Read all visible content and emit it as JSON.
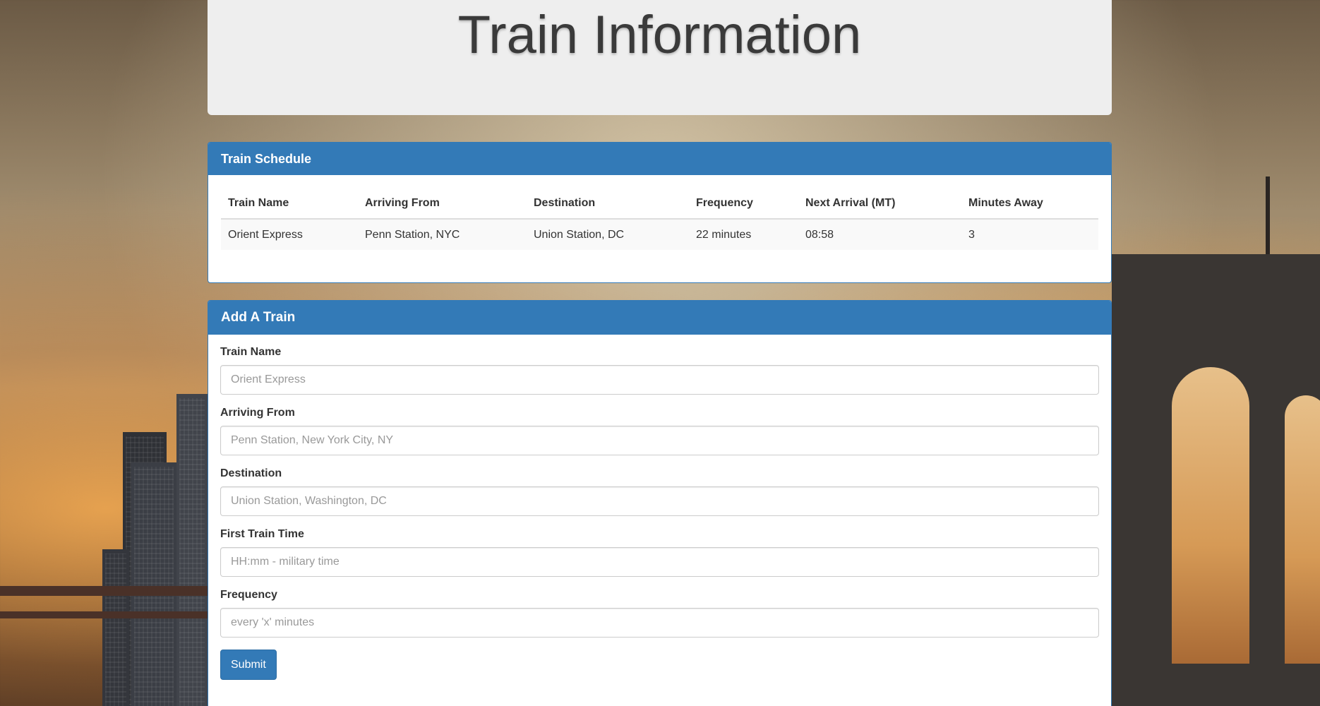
{
  "header": {
    "title": "Train Information"
  },
  "schedule": {
    "title": "Train Schedule",
    "columns": [
      "Train Name",
      "Arriving From",
      "Destination",
      "Frequency",
      "Next Arrival (MT)",
      "Minutes Away"
    ],
    "rows": [
      [
        "Orient Express",
        "Penn Station, NYC",
        "Union Station, DC",
        "22 minutes",
        "08:58",
        "3"
      ]
    ]
  },
  "form": {
    "title": "Add A Train",
    "fields": [
      {
        "label": "Train Name",
        "placeholder": "Orient Express"
      },
      {
        "label": "Arriving From",
        "placeholder": "Penn Station, New York City, NY"
      },
      {
        "label": "Destination",
        "placeholder": "Union Station, Washington, DC"
      },
      {
        "label": "First Train Time",
        "placeholder": "HH:mm - military time"
      },
      {
        "label": "Frequency",
        "placeholder": "every 'x' minutes"
      }
    ],
    "submit_label": "Submit"
  },
  "theme": {
    "primary": "#337ab7",
    "jumbotron_bg": "#eeeeee"
  }
}
